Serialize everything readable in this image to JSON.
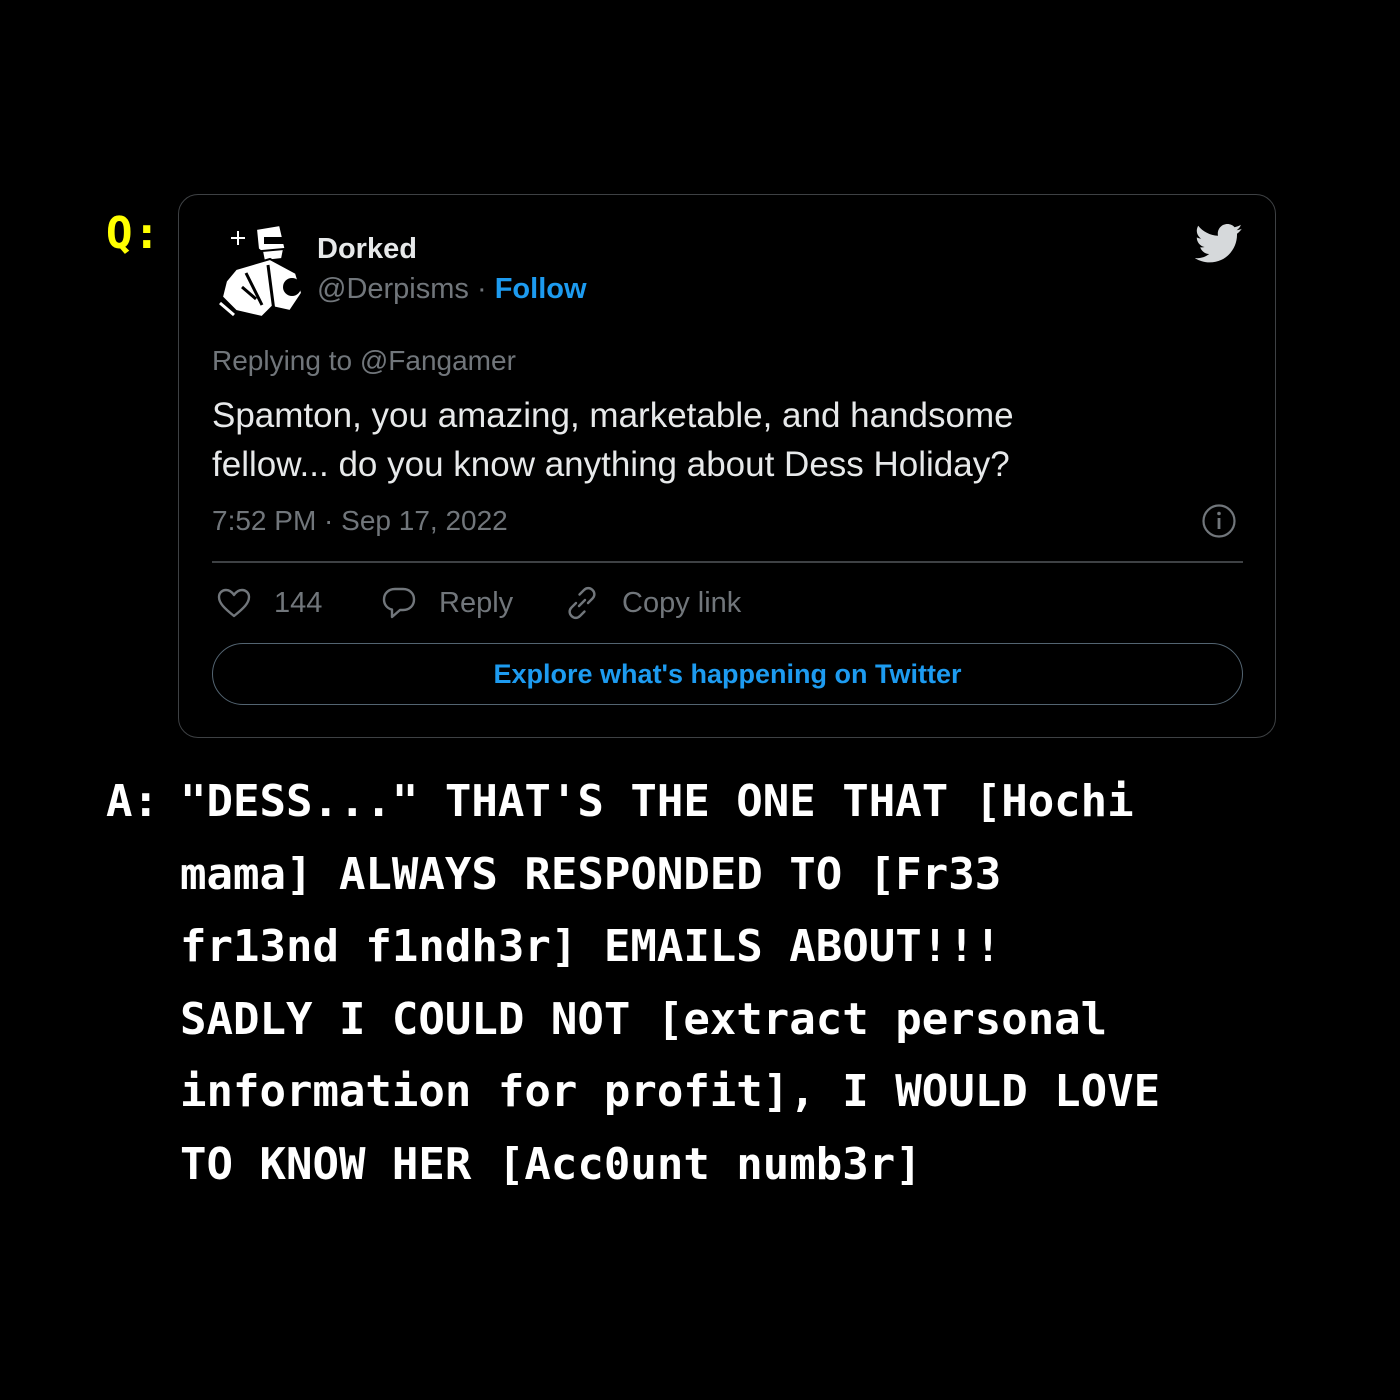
{
  "question_label": "Q:",
  "answer_label": "A:",
  "tweet": {
    "display_name": "Dorked",
    "handle": "@Derpisms",
    "separator": "·",
    "follow_label": "Follow",
    "replying_to": "Replying to @Fangamer",
    "body_lines": [
      "Spamton, you amazing, marketable, and handsome",
      "fellow... do you know anything about Dess Holiday?"
    ],
    "timestamp": "7:52 PM · Sep 17, 2022",
    "actions": {
      "likes_count": "144",
      "reply_label": "Reply",
      "copy_link_label": "Copy link"
    },
    "explore_label": "Explore what's happening on Twitter",
    "icons": {
      "platform": "twitter-bird-icon",
      "info": "info-icon",
      "like": "heart-icon",
      "reply": "speech-bubble-icon",
      "copy": "link-icon"
    }
  },
  "answer_lines": [
    "\"DESS...\" THAT'S THE ONE THAT [Hochi",
    "mama] ALWAYS RESPONDED TO [Fr33",
    "fr13nd f1ndh3r] EMAILS ABOUT!!!",
    "SADLY I COULD NOT [extract personal",
    "information for profit], I WOULD LOVE",
    "TO KNOW HER [Acc0unt numb3r]"
  ],
  "colors": {
    "background": "#000000",
    "question_label": "#ffff00",
    "answer_text": "#ffffff",
    "accent": "#1d9bf0",
    "secondary_text": "#71767b",
    "border": "#3e4144"
  }
}
